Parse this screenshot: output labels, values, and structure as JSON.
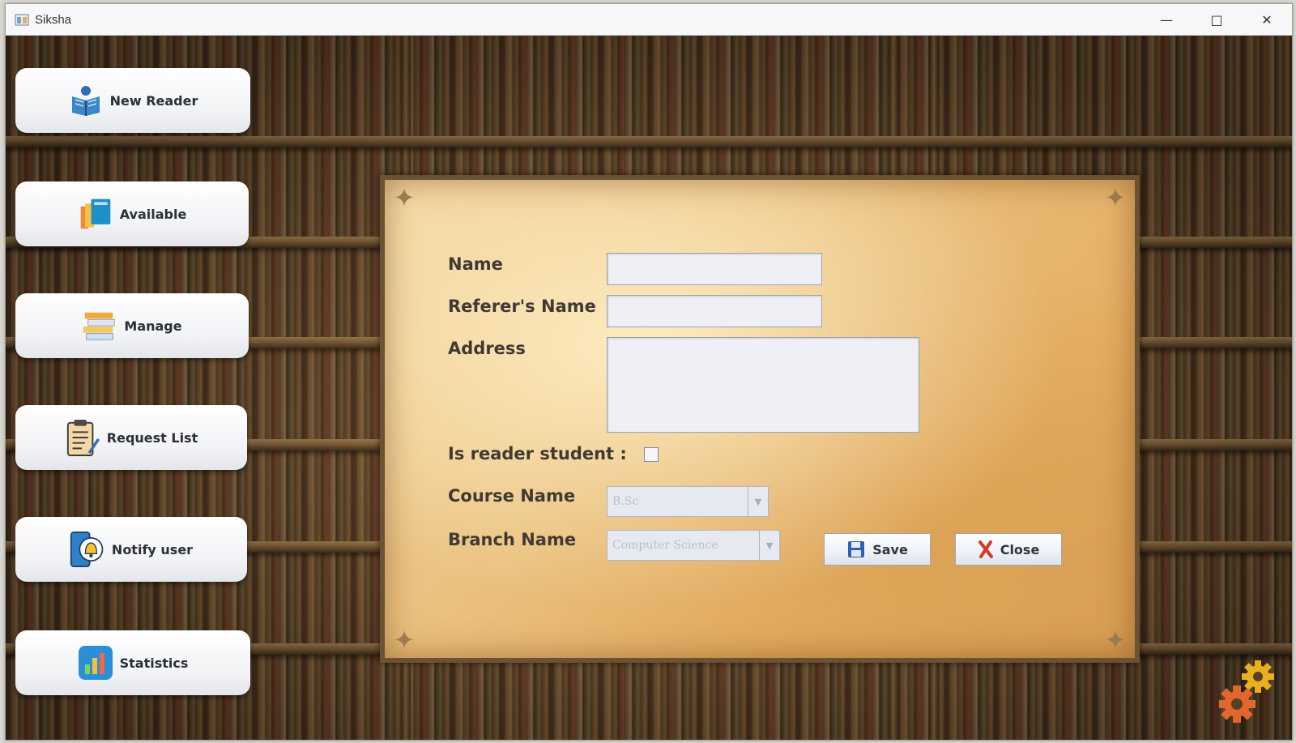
{
  "window": {
    "title": "Siksha",
    "minimize_symbol": "—",
    "maximize_symbol": "□",
    "close_symbol": "✕"
  },
  "sidebar": {
    "items": [
      {
        "label": "New Reader",
        "icon": "reader-book-icon"
      },
      {
        "label": "Available",
        "icon": "books-available-icon"
      },
      {
        "label": "Manage",
        "icon": "stacked-books-icon"
      },
      {
        "label": "Request List",
        "icon": "clipboard-list-icon"
      },
      {
        "label": "Notify user",
        "icon": "bell-phone-icon"
      },
      {
        "label": "Statistics",
        "icon": "bar-chart-icon"
      }
    ]
  },
  "form": {
    "name_label": "Name",
    "name_value": "",
    "referer_label": "Referer's Name",
    "referer_value": "",
    "address_label": "Address",
    "address_value": "",
    "student_label": "Is reader student :",
    "student_checked": false,
    "course_label": "Course Name",
    "course_value": "B.Sc",
    "branch_label": "Branch Name",
    "branch_value": "Computer Science",
    "save_label": "Save",
    "close_label": "Close"
  },
  "colors": {
    "parchment": "#e9bd79",
    "button_text": "#2b2f38",
    "label_text": "#3f3a33",
    "close_x": "#d23a2c",
    "save_icon": "#2f5fb7"
  },
  "footer": {
    "settings_icon": "gear-icon"
  }
}
